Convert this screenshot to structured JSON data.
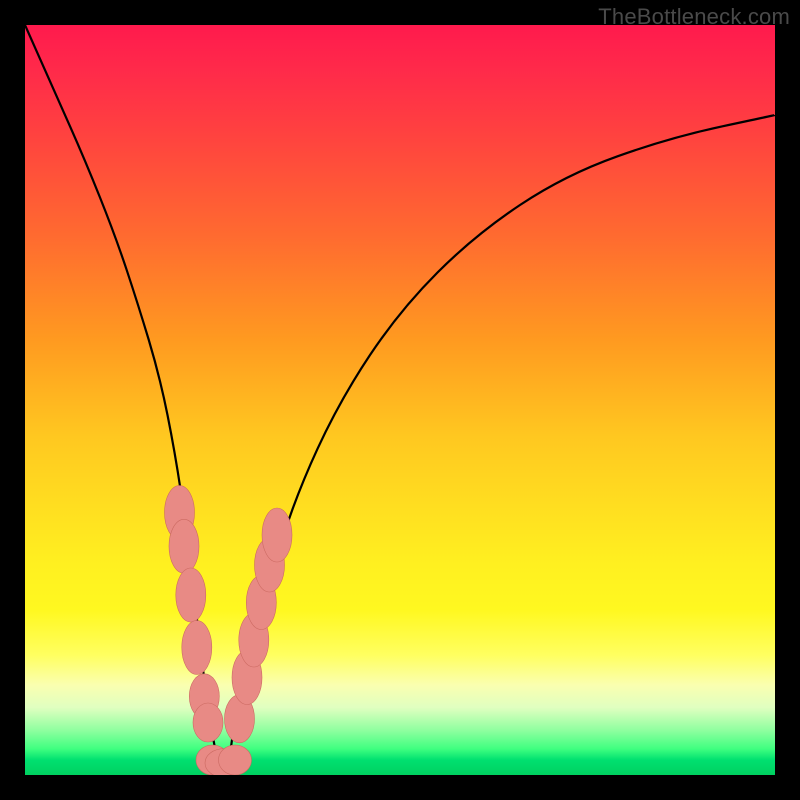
{
  "watermark": "TheBottleneck.com",
  "colors": {
    "frame": "#000000",
    "curve_stroke": "#000000",
    "marker_fill": "#e88a85",
    "marker_stroke": "#cc6a62"
  },
  "chart_data": {
    "type": "line",
    "title": "",
    "xlabel": "",
    "ylabel": "",
    "xlim": [
      0,
      100
    ],
    "ylim": [
      0,
      100
    ],
    "grid": false,
    "legend": false,
    "description": "V-shaped bottleneck curve on rainbow gradient. Y near 0 (green) = balanced; upward (red) = bottleneck.",
    "series": [
      {
        "name": "bottleneck-curve",
        "x": [
          0,
          4,
          8,
          12,
          15,
          18,
          20,
          21.5,
          23,
          24.5,
          26,
          27,
          28,
          32,
          36,
          42,
          50,
          60,
          72,
          86,
          100
        ],
        "y": [
          100,
          91,
          82,
          72,
          63,
          53,
          43,
          33,
          20,
          8,
          0,
          0,
          8,
          24,
          37,
          50,
          62,
          72,
          80,
          85,
          88
        ]
      }
    ],
    "markers": [
      {
        "x": 20.6,
        "y": 35.0,
        "rx": 2.0,
        "ry": 3.6
      },
      {
        "x": 21.2,
        "y": 30.5,
        "rx": 2.0,
        "ry": 3.6
      },
      {
        "x": 22.1,
        "y": 24.0,
        "rx": 2.0,
        "ry": 3.6
      },
      {
        "x": 22.9,
        "y": 17.0,
        "rx": 2.0,
        "ry": 3.6
      },
      {
        "x": 23.9,
        "y": 10.5,
        "rx": 2.0,
        "ry": 3.0
      },
      {
        "x": 24.4,
        "y": 7.0,
        "rx": 2.0,
        "ry": 2.6
      },
      {
        "x": 25.0,
        "y": 2.0,
        "rx": 2.2,
        "ry": 2.0
      },
      {
        "x": 26.5,
        "y": 1.6,
        "rx": 2.5,
        "ry": 1.9
      },
      {
        "x": 28.0,
        "y": 2.0,
        "rx": 2.2,
        "ry": 2.0
      },
      {
        "x": 28.6,
        "y": 7.5,
        "rx": 2.0,
        "ry": 3.2
      },
      {
        "x": 29.6,
        "y": 13.0,
        "rx": 2.0,
        "ry": 3.6
      },
      {
        "x": 30.5,
        "y": 18.0,
        "rx": 2.0,
        "ry": 3.6
      },
      {
        "x": 31.5,
        "y": 23.0,
        "rx": 2.0,
        "ry": 3.6
      },
      {
        "x": 32.6,
        "y": 28.0,
        "rx": 2.0,
        "ry": 3.6
      },
      {
        "x": 33.6,
        "y": 32.0,
        "rx": 2.0,
        "ry": 3.6
      }
    ]
  }
}
